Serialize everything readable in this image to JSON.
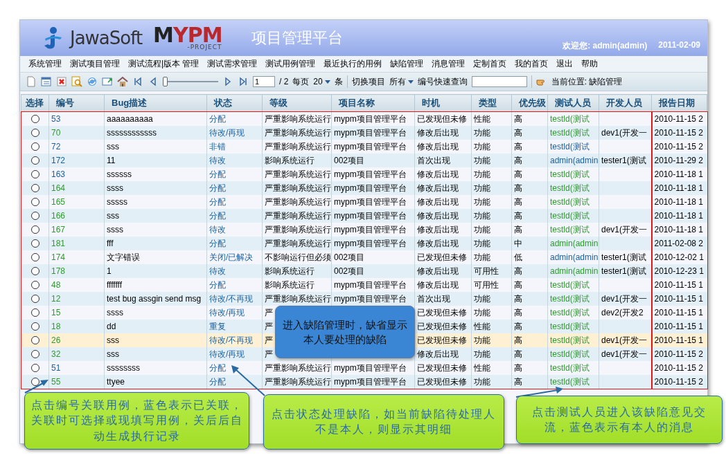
{
  "header": {
    "brand": "JawaSoft",
    "product_first": "M",
    "product_rest": "YPM",
    "product_sub": "-PROJECT",
    "title": "项目管理平台",
    "welcome": "欢迎您: admin(admin)",
    "date": "2011-02-09"
  },
  "menu": [
    "系统管理",
    "测试项目管理",
    "测试流程|版本 管理",
    "测试需求管理",
    "测试用例管理",
    "最近执行的用例",
    "缺陷管理",
    "消息管理",
    "定制首页",
    "我的首页",
    "退出",
    "帮助"
  ],
  "toolbar": {
    "page": "1",
    "page_total": "/ 2",
    "per_page_label": "每页",
    "per_page": "20",
    "unit": "条",
    "switch_project": "切换项目",
    "project_filter": "所有",
    "quick_search_label": "编号快速查询",
    "location": "当前位置: 缺陷管理",
    "pager": {
      "level": 0
    }
  },
  "table": {
    "columns": [
      "选择",
      "编号",
      "Bug描述",
      "状态",
      "等级",
      "项目名称",
      "时机",
      "类型",
      "优先级",
      "测试人员",
      "开发人员",
      "报告日期"
    ],
    "rows": [
      {
        "checked": false,
        "selected": false,
        "id": "53",
        "linked": true,
        "description": "aaaaaaaaaa",
        "status": "分配",
        "severity": "严重影响系统运行",
        "project": "mypm项目管理平台",
        "occurrence": "已发现但未修",
        "type": "性能",
        "priority": "高",
        "tester": "testld(测试",
        "has_message": false,
        "report_date": "2010-11-15 2"
      },
      {
        "checked": false,
        "selected": false,
        "id": "70",
        "linked": false,
        "description": "ssssssssssss",
        "status": "待改/再现",
        "severity": "严重影响系统运行",
        "project": "mypm项目管理平台",
        "occurrence": "修改后出现",
        "type": "功能",
        "priority": "高",
        "tester": "testld(测试",
        "has_message": false,
        "developer": "dev1(开发一",
        "report_date": "2010-11-15 2"
      },
      {
        "checked": false,
        "selected": false,
        "id": "72",
        "linked": true,
        "description": "sss",
        "status": "非错",
        "severity": "严重影响系统运行",
        "project": "mypm项目管理平台",
        "occurrence": "修改后出现",
        "type": "功能",
        "priority": "高",
        "tester": "testld(测试",
        "has_message": true,
        "report_date": "2010-11-15 2"
      },
      {
        "checked": false,
        "selected": false,
        "id": "172",
        "linked": true,
        "description": "11",
        "status": "待改",
        "severity": "影响系统运行",
        "project": "002项目",
        "occurrence": "首次出现",
        "type": "功能",
        "priority": "高",
        "tester": "admin(admin",
        "has_message": true,
        "developer": "tester1(测试",
        "report_date": "2010-11-29 2"
      },
      {
        "checked": false,
        "selected": false,
        "id": "163",
        "linked": true,
        "description": "ssssss",
        "status": "分配",
        "severity": "严重影响系统运行",
        "project": "mypm项目管理平台",
        "occurrence": "修改后出现",
        "type": "功能",
        "priority": "高",
        "tester": "testld(测试",
        "has_message": false,
        "report_date": "2010-11-18 1"
      },
      {
        "checked": false,
        "selected": false,
        "id": "164",
        "linked": false,
        "description": "ssss",
        "status": "分配",
        "severity": "严重影响系统运行",
        "project": "mypm项目管理平台",
        "occurrence": "修改后出现",
        "type": "功能",
        "priority": "高",
        "tester": "testld(测试",
        "has_message": false,
        "report_date": "2010-11-18 1"
      },
      {
        "checked": false,
        "selected": false,
        "id": "165",
        "linked": false,
        "description": "sssss",
        "status": "分配",
        "severity": "严重影响系统运行",
        "project": "mypm项目管理平台",
        "occurrence": "修改后出现",
        "type": "功能",
        "priority": "高",
        "tester": "testld(测试",
        "has_message": false,
        "report_date": "2010-11-18 1"
      },
      {
        "checked": false,
        "selected": false,
        "id": "166",
        "linked": false,
        "description": "sss",
        "status": "分配",
        "severity": "严重影响系统运行",
        "project": "mypm项目管理平台",
        "occurrence": "修改后出现",
        "type": "功能",
        "priority": "高",
        "tester": "testld(测试",
        "has_message": false,
        "report_date": "2010-11-18 1"
      },
      {
        "checked": false,
        "selected": false,
        "id": "167",
        "linked": false,
        "description": "ssss",
        "status": "待改",
        "severity": "严重影响系统运行",
        "project": "mypm项目管理平台",
        "occurrence": "修改后出现",
        "type": "功能",
        "priority": "高",
        "tester": "testld(测试",
        "has_message": false,
        "developer": "dev1(开发一",
        "report_date": "2010-11-18 1"
      },
      {
        "checked": false,
        "selected": false,
        "id": "181",
        "linked": false,
        "description": "fff",
        "status": "分配",
        "severity": "严重影响系统运行",
        "project": "mypm项目管理平台",
        "occurrence": "修改后出现",
        "type": "功能",
        "priority": "中",
        "tester": "admin(admin",
        "has_message": false,
        "report_date": "2011-02-08 2"
      },
      {
        "checked": false,
        "selected": false,
        "id": "174",
        "linked": false,
        "description": "文字错误",
        "status": "关闭/已解决",
        "severity": "不影响运行但必须",
        "project": "002项目",
        "occurrence": "已发现但未修",
        "type": "功能",
        "priority": "低",
        "tester": "admin(admin",
        "has_message": true,
        "developer": "tester1(测试",
        "report_date": "2010-12-02 1"
      },
      {
        "checked": false,
        "selected": false,
        "id": "178",
        "linked": false,
        "description": "1",
        "status": "待改",
        "severity": "影响系统运行",
        "project": "002项目",
        "occurrence": "修改后出现",
        "type": "可用性",
        "priority": "高",
        "tester": "admin(admin",
        "has_message": false,
        "developer": "tester1(测试",
        "report_date": "2010-12-23 1"
      },
      {
        "checked": false,
        "selected": false,
        "id": "48",
        "linked": false,
        "description": "fffffff",
        "status": "分配",
        "severity": "影响系统运行",
        "project": "mypm项目管理平台",
        "occurrence": "修改后出现",
        "type": "可用性",
        "priority": "高",
        "tester": "testld(测试",
        "has_message": false,
        "report_date": "2010-11-15 1"
      },
      {
        "checked": false,
        "selected": false,
        "id": "12",
        "linked": false,
        "description": "test bug assgin send msg",
        "status": "待改/不再现",
        "severity": "严重影响系统运行",
        "project": "mypm项目管理平台",
        "occurrence": "首次出现",
        "type": "功能",
        "priority": "高",
        "tester": "testld(测试",
        "has_message": false,
        "developer": "dev1(开发一",
        "report_date": "2010-11-15 1"
      },
      {
        "checked": false,
        "selected": false,
        "id": "15",
        "linked": false,
        "description": "ssss",
        "status": "待改/再现",
        "severity": "严",
        "occurrence": "已发现但未修",
        "type": "功能",
        "priority": "高",
        "tester": "testld(测试",
        "has_message": false,
        "developer": "dev2(开发2",
        "report_date": "2010-11-15 1"
      },
      {
        "checked": false,
        "selected": false,
        "id": "18",
        "linked": false,
        "description": "dd",
        "status": "重复",
        "severity": "严",
        "occurrence": "已发现但未修",
        "type": "性能",
        "priority": "高",
        "tester": "testld(测试",
        "has_message": false,
        "report_date": "2010-11-15 1"
      },
      {
        "checked": false,
        "selected": true,
        "id": "26",
        "linked": false,
        "description": "sss",
        "status": "待改/不再现",
        "severity": "严",
        "occurrence": "已发现但未修",
        "type": "功能",
        "priority": "高",
        "tester": "testld(测试",
        "has_message": false,
        "developer": "dev1(开发一",
        "report_date": "2010-11-15 1"
      },
      {
        "checked": false,
        "selected": false,
        "id": "32",
        "linked": false,
        "description": "sss",
        "status": "待改/再现",
        "severity": "严",
        "occurrence": "修改后出现",
        "type": "功能",
        "priority": "高",
        "tester": "testld(测试",
        "has_message": false,
        "developer": "dev1(开发一",
        "report_date": "2010-11-15 2"
      },
      {
        "checked": false,
        "selected": false,
        "id": "51",
        "linked": true,
        "description": "ssssssss",
        "status": "分配",
        "severity": "严重影响系统运行",
        "project": "mypm项目管理平台",
        "occurrence": "已发现但未修",
        "type": "性能",
        "priority": "高",
        "tester": "testld(测试",
        "has_message": false,
        "report_date": "2010-11-15 2"
      },
      {
        "checked": false,
        "selected": false,
        "id": "55",
        "linked": false,
        "description": "ttyee",
        "status": "分配",
        "severity": "严重影响系统运行",
        "project": "mypm项目管理平台",
        "occurrence": "已发现但未修",
        "type": "功能",
        "priority": "高",
        "tester": "testld(测试",
        "has_message": false,
        "report_date": "2010-11-15 2"
      }
    ]
  },
  "callouts": [
    {
      "kind": "blue",
      "text": "进入缺陷管理时，缺省显示本人要处理的缺陷"
    },
    {
      "kind": "green",
      "text": "点击编号关联用例，蓝色表示已关联，关联时可选择或现填写用例，关后后自动生成执行记录"
    },
    {
      "kind": "green",
      "text": "点击状态处理缺陷，如当前缺陷待处理人不是本人，则显示其明细"
    },
    {
      "kind": "green",
      "text": "点击测试人员进入该缺陷意见交流，蓝色表示有本人的消息"
    }
  ]
}
